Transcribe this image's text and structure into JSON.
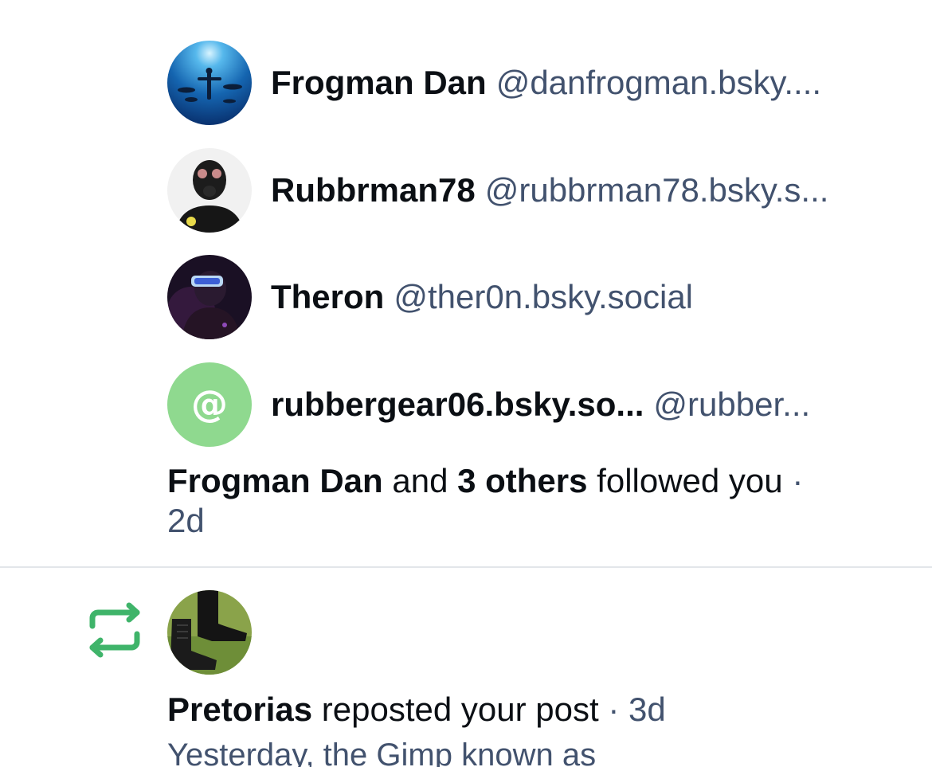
{
  "followers": [
    {
      "display_name": "Frogman Dan",
      "handle": "@danfrogman.bsky....",
      "avatar_icon": "underwater-diver-avatar"
    },
    {
      "display_name": "Rubbrman78",
      "handle": "@rubbrman78.bsky.s...",
      "avatar_icon": "gas-mask-avatar"
    },
    {
      "display_name": "Theron",
      "handle": "@ther0n.bsky.social",
      "avatar_icon": "neon-goggles-avatar"
    },
    {
      "display_name": "rubbergear06.bsky.so...",
      "handle": "@rubber...",
      "avatar_icon": "at-sign-default-avatar",
      "avatar_color": "#8fd98f"
    }
  ],
  "follow_summary": {
    "first_name": "Frogman Dan",
    "connector": "and",
    "others": "3 others",
    "action": "followed you",
    "separator": "·",
    "time": "2d"
  },
  "repost": {
    "icon": "repost-icon",
    "icon_color": "#3fb46a",
    "avatar_icon": "boots-avatar",
    "name": "Pretorias",
    "action": "reposted your post",
    "separator": "·",
    "time": "3d",
    "preview": "Yesterday, the Gimp known as"
  },
  "colors": {
    "text_primary": "#0b0f14",
    "text_muted": "#42526e",
    "divider": "#e3e6ea"
  }
}
